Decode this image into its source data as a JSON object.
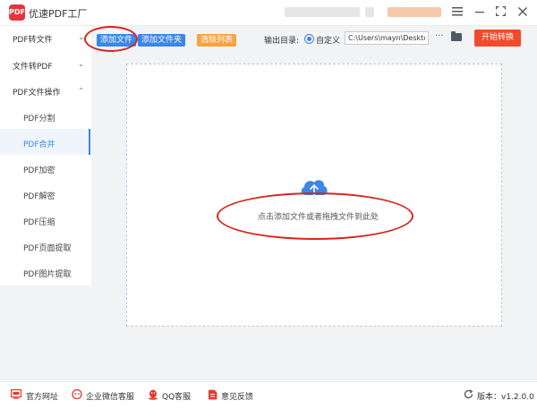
{
  "app": {
    "title": "优速PDF工厂",
    "logo_text": "PDF"
  },
  "window": {
    "menu_icon": "hamburger-icon",
    "minimize_icon": "minimize-icon",
    "maximize_icon": "maximize-icon",
    "close_icon": "close-icon"
  },
  "sidebar": {
    "categories": [
      {
        "label": "PDF转文件",
        "expanded": false
      },
      {
        "label": "文件转PDF",
        "expanded": false
      },
      {
        "label": "PDF文件操作",
        "expanded": true
      }
    ],
    "items": [
      "PDF分割",
      "PDF合并",
      "PDF加密",
      "PDF解密",
      "PDF压缩",
      "PDF页面提取",
      "PDF图片提取"
    ],
    "active_item": "PDF合并"
  },
  "toolbar": {
    "add_file": "添加文件",
    "add_folder": "添加文件夹",
    "clear_list": "清除列表",
    "output_label": "输出目录:",
    "output_option": "自定义",
    "output_path": "C:\\Users\\mayn\\Desktop",
    "more": "···",
    "start": "开始转换"
  },
  "dropzone": {
    "text": "点击添加文件或者拖拽文件到此处",
    "icon": "cloud-upload-icon"
  },
  "footer": {
    "website": "官方网址",
    "wechat": "企业微信客服",
    "qq": "QQ客服",
    "feedback": "意见反馈",
    "version": "版本：v1.2.0.0"
  },
  "colors": {
    "accent": "#3b86e6",
    "start_button": "#ef4b2c",
    "clear_button": "#f6a340",
    "annotation": "#d7261a"
  }
}
